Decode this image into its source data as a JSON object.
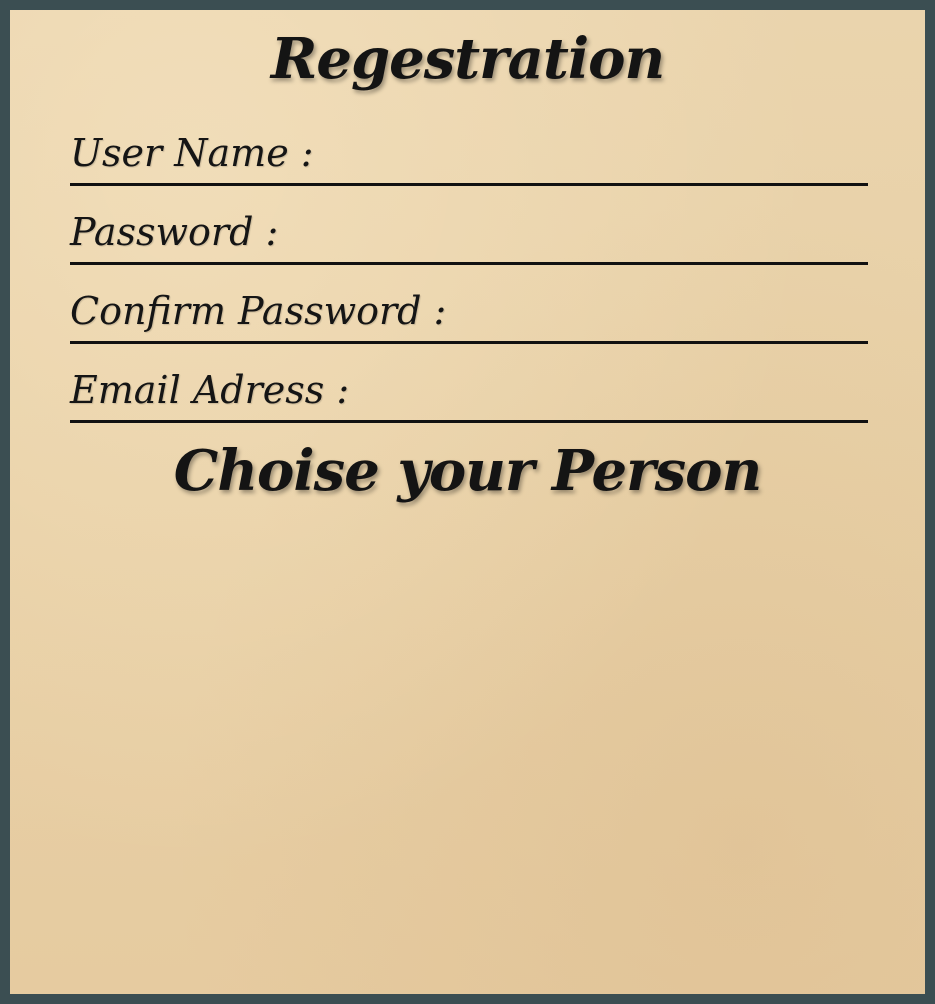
{
  "form": {
    "title": "Regestration",
    "fields": [
      {
        "label": "User Name :",
        "value": "",
        "type": "text"
      },
      {
        "label": "Password :",
        "value": "",
        "type": "password"
      },
      {
        "label": "Confirm Password :",
        "value": "",
        "type": "password"
      },
      {
        "label": "Email Adress :",
        "value": "",
        "type": "email"
      }
    ],
    "person_heading": "Choise your Person"
  },
  "colors": {
    "frame": "#3b4e52",
    "paper": "#e8d0a6",
    "ink": "#141414"
  }
}
